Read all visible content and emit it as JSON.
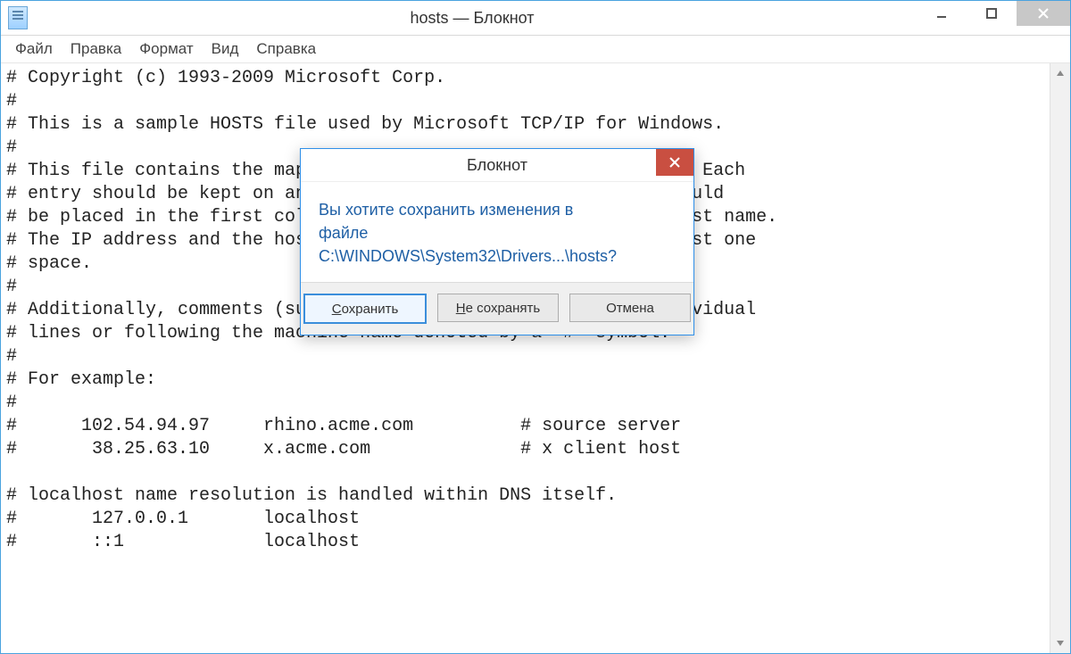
{
  "window": {
    "title": "hosts — Блокнот"
  },
  "menu": {
    "file": "Файл",
    "edit": "Правка",
    "format": "Формат",
    "view": "Вид",
    "help": "Справка"
  },
  "editor": {
    "content": "# Copyright (c) 1993-2009 Microsoft Corp.\n#\n# This is a sample HOSTS file used by Microsoft TCP/IP for Windows.\n#\n# This file contains the mappings of IP addresses to host names. Each\n# entry should be kept on an individual line. The IP address should\n# be placed in the first column followed by the corresponding host name.\n# The IP address and the host name should be separated by at least one\n# space.\n#\n# Additionally, comments (such as these) may be inserted on individual\n# lines or following the machine name denoted by a '#' symbol.\n#\n# For example:\n#\n#      102.54.94.97     rhino.acme.com          # source server\n#       38.25.63.10     x.acme.com              # x client host\n\n# localhost name resolution is handled within DNS itself.\n#       127.0.0.1       localhost\n#       ::1             localhost"
  },
  "dialog": {
    "title": "Блокнот",
    "line1": "Вы хотите сохранить изменения в",
    "line2": "файле",
    "line3": "C:\\WINDOWS\\System32\\Drivers...\\hosts?",
    "save_prefix": "С",
    "save_rest": "охранить",
    "dont_prefix": "Н",
    "dont_rest": "е сохранять",
    "cancel": "Отмена"
  }
}
